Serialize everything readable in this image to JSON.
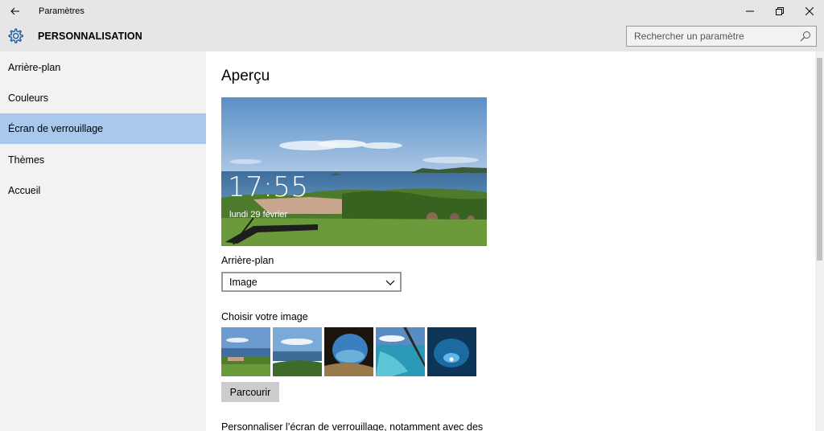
{
  "window": {
    "title": "Paramètres",
    "back_icon": "back-arrow-icon",
    "minimize_icon": "minimize-icon",
    "maximize_icon": "restore-icon",
    "close_icon": "close-icon"
  },
  "header": {
    "icon": "gear-icon",
    "title": "PERSONNALISATION",
    "accent": "#1d5fa8"
  },
  "search": {
    "placeholder": "Rechercher un paramètre",
    "icon": "search-icon"
  },
  "sidebar": {
    "items": [
      {
        "label": "Arrière-plan",
        "selected": false
      },
      {
        "label": "Couleurs",
        "selected": false
      },
      {
        "label": "Écran de verrouillage",
        "selected": true
      },
      {
        "label": "Thèmes",
        "selected": false
      },
      {
        "label": "Accueil",
        "selected": false
      }
    ],
    "selected_color": "#a8c9ec"
  },
  "main": {
    "title": "Aperçu",
    "preview": {
      "time": "17:55",
      "date": "lundi 29 février"
    },
    "background_label": "Arrière-plan",
    "background_select": {
      "value": "Image",
      "icon": "chevron-down-icon"
    },
    "choose_label": "Choisir votre image",
    "browse_label": "Parcourir",
    "description": "Personnaliser l’écran de verrouillage, notamment avec des"
  }
}
